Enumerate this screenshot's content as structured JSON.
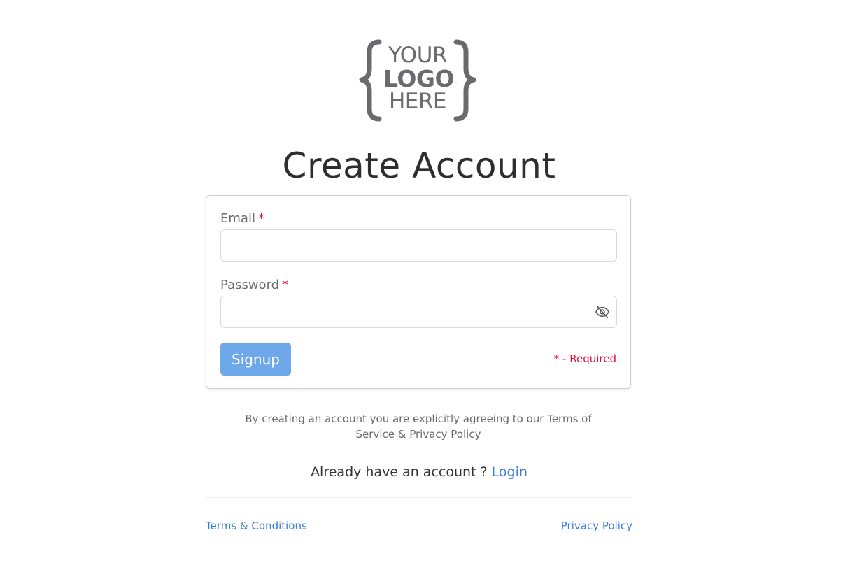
{
  "logo": {
    "line1": "YOUR",
    "line2": "LOGO",
    "line3": "HERE",
    "color": "#6b6b6f"
  },
  "title": "Create Account",
  "form": {
    "email": {
      "label": "Email",
      "required_mark": "*",
      "value": "",
      "placeholder": ""
    },
    "password": {
      "label": "Password",
      "required_mark": "*",
      "value": "",
      "placeholder": "",
      "toggle_icon": "eye-off-icon"
    },
    "submit_label": "Signup",
    "required_note": "* - Required"
  },
  "agreement_text": "By creating an account you are explicitly agreeing to our Terms of Service & Privacy Policy",
  "login": {
    "prompt": "Already have an account ?",
    "link_label": "Login"
  },
  "footer": {
    "terms_label": "Terms & Conditions",
    "privacy_label": "Privacy Policy"
  },
  "colors": {
    "primary_button": "#6fa8ea",
    "link": "#3b7ddd",
    "required": "#e0103a",
    "title": "#2e2e2e"
  }
}
